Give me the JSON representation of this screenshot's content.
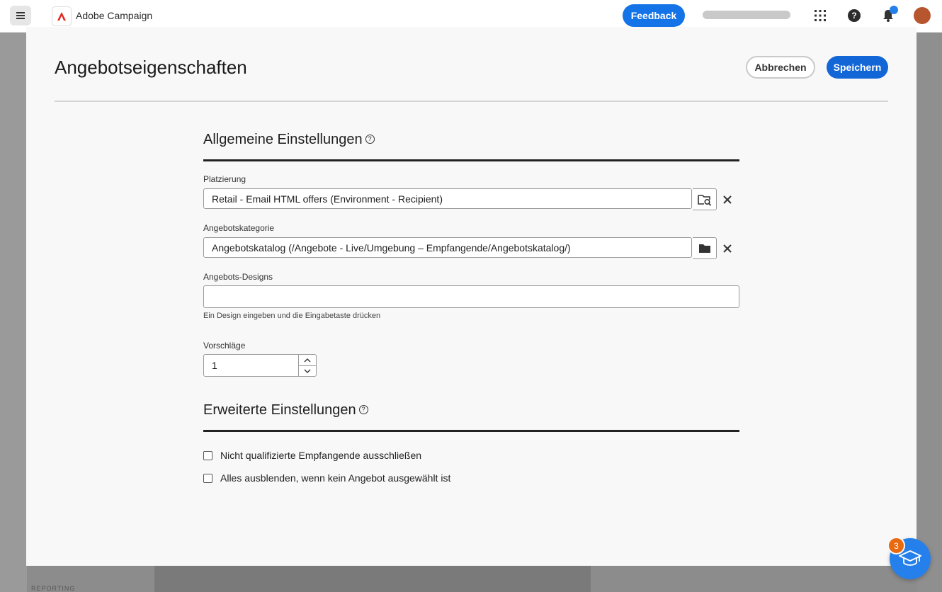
{
  "app": {
    "name": "Adobe Campaign",
    "feedback_label": "Feedback",
    "help_glyph": "?",
    "reporting_label": "REPORTING"
  },
  "modal": {
    "title": "Angebotseigenschaften",
    "cancel_label": "Abbrechen",
    "save_label": "Speichern",
    "general": {
      "title": "Allgemeine Einstellungen",
      "info_glyph": "?",
      "placement_label": "Platzierung",
      "placement_value": "Retail - Email HTML offers (Environment - Recipient)",
      "category_label": "Angebotskategorie",
      "category_value": "Angebotskatalog (/Angebote - Live/Umgebung – Empfangende/Angebotskatalog/)",
      "designs_label": "Angebots-Designs",
      "designs_value": "",
      "designs_help": "Ein Design eingeben und die Eingabetaste drücken",
      "proposals_label": "Vorschläge",
      "proposals_value": "1"
    },
    "advanced": {
      "title": "Erweiterte Einstellungen",
      "info_glyph": "?",
      "checkbox1_label": "Nicht qualifizierte Empfangende ausschließen",
      "checkbox1_checked": false,
      "checkbox2_label": "Alles ausblenden, wenn kein Angebot ausgewählt ist",
      "checkbox2_checked": false
    }
  },
  "help_fab": {
    "badge_count": "3"
  },
  "colors": {
    "accent": "#1366d6",
    "badge": "#e8690f",
    "fab": "#2680eb"
  }
}
